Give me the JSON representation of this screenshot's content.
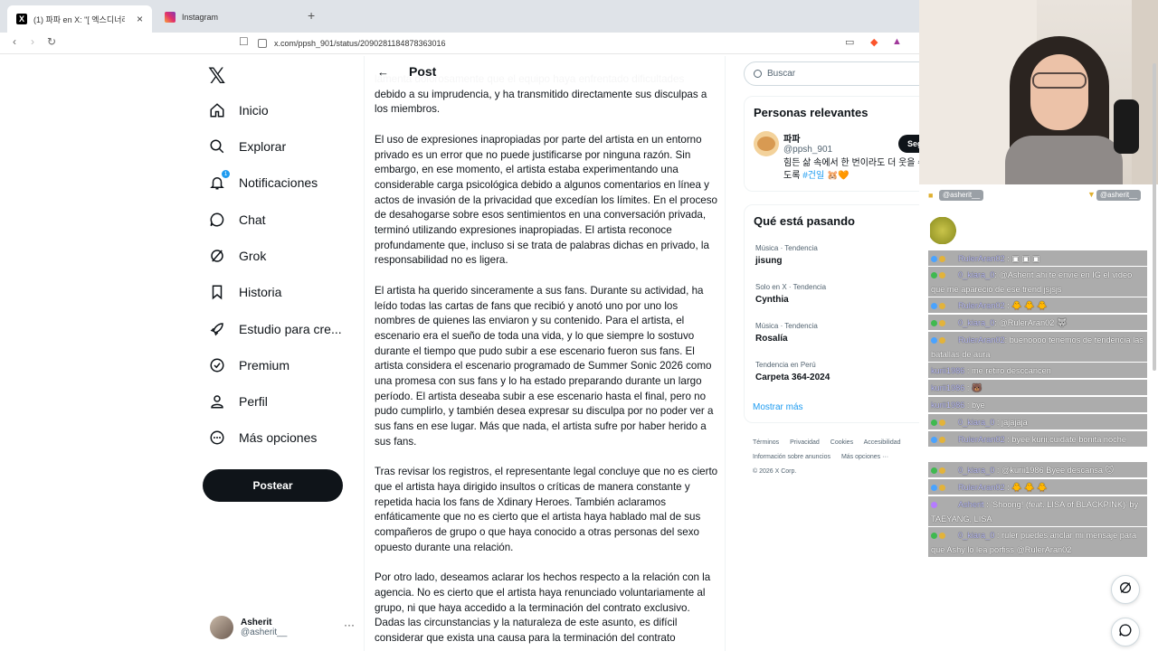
{
  "browser": {
    "tabs": [
      {
        "label": "(1) 파파 en X: \"[ 엑스디너리 히어",
        "active": true
      },
      {
        "label": "Instagram",
        "active": false
      }
    ],
    "url": "x.com/ppsh_901/status/2090281184878363016"
  },
  "nav": {
    "items": [
      {
        "label": "Inicio",
        "icon": "home-icon"
      },
      {
        "label": "Explorar",
        "icon": "search-icon"
      },
      {
        "label": "Notificaciones",
        "icon": "bell-icon",
        "badge": "1"
      },
      {
        "label": "Chat",
        "icon": "chat-icon"
      },
      {
        "label": "Grok",
        "icon": "grok-icon"
      },
      {
        "label": "Historia",
        "icon": "bookmark-icon"
      },
      {
        "label": "Estudio para cre...",
        "icon": "rocket-icon"
      },
      {
        "label": "Premium",
        "icon": "verified-icon"
      },
      {
        "label": "Perfil",
        "icon": "person-icon"
      },
      {
        "label": "Más opciones",
        "icon": "more-icon"
      }
    ],
    "post_button": "Postear",
    "account": {
      "name": "Asherit",
      "handle": "@asherit__"
    }
  },
  "main": {
    "title": "Post",
    "paragraphs": [
      "lamenta dolorosamente que el equipo haya enfrentado dificultades debido a su imprudencia, y ha transmitido directamente sus disculpas a los miembros.",
      "El uso de expresiones inapropiadas por parte del artista en un entorno privado es un error que no puede justificarse por ninguna razón. Sin embargo, en ese momento, el artista estaba experimentando una considerable carga psicológica debido a algunos comentarios en línea y actos de invasión de la privacidad que excedían los límites. En el proceso de desahogarse sobre esos sentimientos en una conversación privada, terminó utilizando expresiones inapropiadas. El artista reconoce profundamente que, incluso si se trata de palabras dichas en privado, la responsabilidad no es ligera.",
      "El artista ha querido sinceramente a sus fans. Durante su actividad, ha leído todas las cartas de fans que recibió y anotó uno por uno los nombres de quienes las enviaron y su contenido. Para el artista, el escenario era el sueño de toda una vida, y lo que siempre lo sostuvo durante el tiempo que pudo subir a ese escenario fueron sus fans. El artista considera el escenario programado de Summer Sonic 2026 como una promesa con sus fans y lo ha estado preparando durante un largo período. El artista deseaba subir a ese escenario hasta el final, pero no pudo cumplirlo, y también desea expresar su disculpa por no poder ver a sus fans en ese lugar. Más que nada, el artista sufre por haber herido a sus fans.",
      "Tras revisar los registros, el representante legal concluye que no es cierto que el artista haya dirigido insultos o críticas de manera constante y repetida hacia los fans de Xdinary Heroes. También aclaramos enfáticamente que no es cierto que el artista haya hablado mal de sus compañeros de grupo o que haya conocido a otras personas del sexo opuesto durante una relación.",
      "Por otro lado, deseamos aclarar los hechos respecto a la relación con la agencia. No es cierto que el artista haya renunciado voluntariamente al grupo, ni que haya accedido a la terminación del contrato exclusivo. Dadas las circunstancias y la naturaleza de este asunto, es difícil considerar que exista una causa para la terminación del contrato"
    ]
  },
  "right": {
    "search_placeholder": "Buscar",
    "relevant_title": "Personas relevantes",
    "person": {
      "name": "파파",
      "handle": "@ppsh_901",
      "bio_text": "힘든 삶 속에서 한 번이라도 더 웃을 수 있도록 ",
      "bio_hashtag": "#건일",
      "bio_emoji": "🐹🧡",
      "follow_label": "Seguir"
    },
    "trending_title": "Qué está pasando",
    "trends": [
      {
        "category": "Música · Tendencia",
        "name": "jisung"
      },
      {
        "category": "Solo en X · Tendencia",
        "name": "Cynthia"
      },
      {
        "category": "Música · Tendencia",
        "name": "Rosalía"
      },
      {
        "category": "Tendencia en Perú",
        "name": "Carpeta 364-2024"
      }
    ],
    "show_more": "Mostrar más",
    "footer": {
      "line1": [
        "Términos",
        "Privacidad",
        "Cookies",
        "Accesibilidad"
      ],
      "line2": [
        "Información sobre anuncios",
        "Más opciones ···"
      ],
      "copyright": "© 2026 X Corp."
    }
  },
  "overlay": {
    "alerts": [
      {
        "label": "@asherit__"
      },
      {
        "label": "@asherit__"
      }
    ],
    "chat": [
      {
        "user": "RulerAran02",
        "text": " :",
        "emotes": "▣ ▣ ▣"
      },
      {
        "user": "0_kiara_0",
        "text": ": @Asherit ahi te envie en IG el video que me apareció de ese trend jsjsjs"
      },
      {
        "user": "RulerAran02",
        "text": " :",
        "emotes": "🐥 🐥 🐥"
      },
      {
        "user": "0_kiara_0",
        "text": ": @RulerAran02",
        "emotes": "🐺"
      },
      {
        "user": "RulerAran02",
        "text": ": buenoooo tenemos de tendencia las batallas de aura"
      },
      {
        "user": "kurii1986",
        "text": ": me retiro desccancen"
      },
      {
        "user": "kurii1986",
        "text": " :",
        "emotes": "🐻"
      },
      {
        "user": "kurii1986",
        "text": ": bye"
      },
      {
        "user": "0_kiara_0",
        "text": ": jajajaja"
      },
      {
        "user": "RulerAran02",
        "text": ": byee kurii,cuidate bonita noche"
      },
      {
        "user": "0_kiara_0",
        "text": ": @kurii1986 Byee descansa",
        "emotes": "🐱"
      },
      {
        "user": "RulerAran02",
        "text": " :",
        "emotes": "🐥 🐥 🐥"
      },
      {
        "user": "Asherit",
        "text": ": 'Shoong! (feat. LISA of BLACKPINK)' by TAEYANG, LISA"
      },
      {
        "user": "0_kiara_0",
        "text": ": ruler puedes anclar mi mensaje para que Ashy lo lea porfiss @RulerAran02"
      }
    ]
  },
  "colors": {
    "accent": "#1d9bf0",
    "text": "#0f1419",
    "muted": "#536471",
    "post_button": "#0f1419"
  }
}
